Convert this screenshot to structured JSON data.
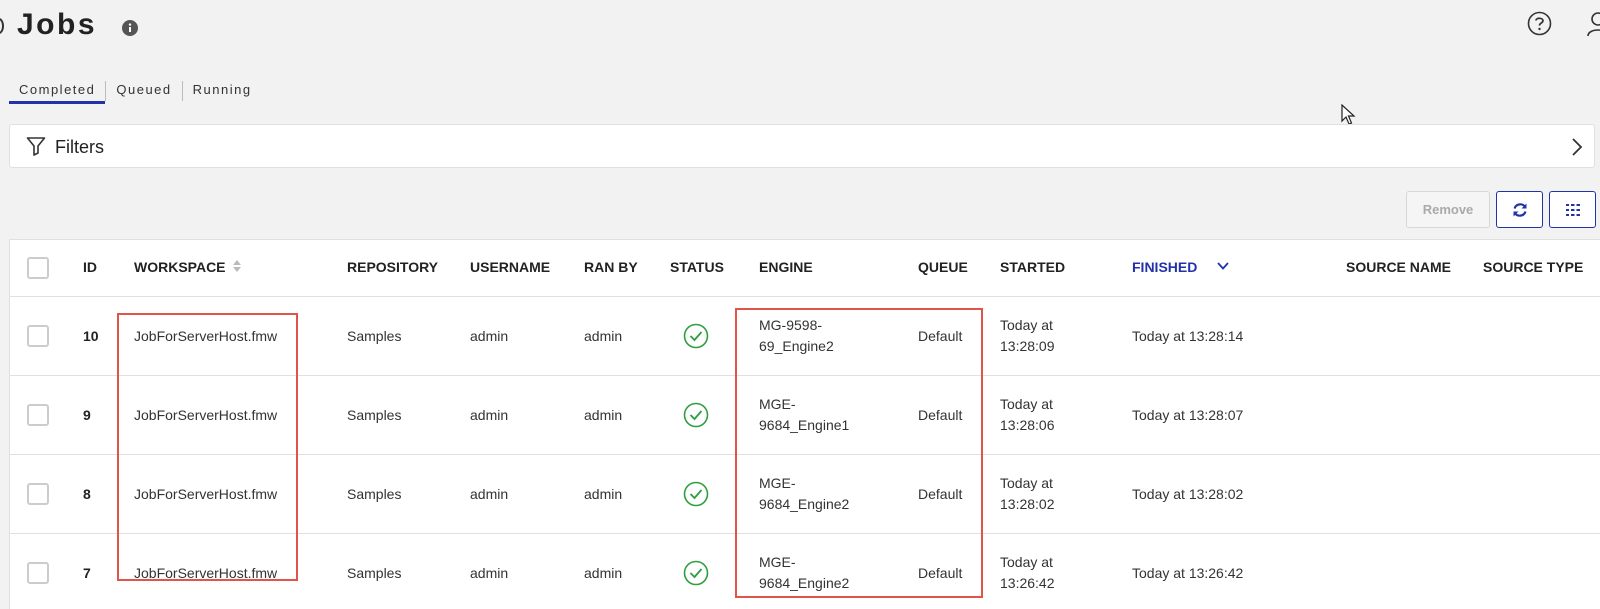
{
  "page": {
    "title": "Jobs"
  },
  "tabs": [
    {
      "label": "Completed"
    },
    {
      "label": "Queued"
    },
    {
      "label": "Running"
    }
  ],
  "filters": {
    "label": "Filters"
  },
  "toolbar": {
    "remove_label": "Remove"
  },
  "table": {
    "columns": {
      "id": "ID",
      "workspace": "WORKSPACE",
      "repository": "REPOSITORY",
      "username": "USERNAME",
      "ran_by": "RAN BY",
      "status": "STATUS",
      "engine": "ENGINE",
      "queue": "QUEUE",
      "started": "STARTED",
      "finished": "FINISHED",
      "source_name": "SOURCE NAME",
      "source_type": "SOURCE TYPE"
    },
    "rows": [
      {
        "id": "10",
        "workspace": "JobForServerHost.fmw",
        "repository": "Samples",
        "username": "admin",
        "ran_by": "admin",
        "status": "success",
        "engine_1": "MG-9598-",
        "engine_2": "69_Engine2",
        "queue": "Default",
        "started_1": "Today at",
        "started_2": "13:28:09",
        "finished": "Today at 13:28:14"
      },
      {
        "id": "9",
        "workspace": "JobForServerHost.fmw",
        "repository": "Samples",
        "username": "admin",
        "ran_by": "admin",
        "status": "success",
        "engine_1": "MGE-",
        "engine_2": "9684_Engine1",
        "queue": "Default",
        "started_1": "Today at",
        "started_2": "13:28:06",
        "finished": "Today at 13:28:07"
      },
      {
        "id": "8",
        "workspace": "JobForServerHost.fmw",
        "repository": "Samples",
        "username": "admin",
        "ran_by": "admin",
        "status": "success",
        "engine_1": "MGE-",
        "engine_2": "9684_Engine2",
        "queue": "Default",
        "started_1": "Today at",
        "started_2": "13:28:02",
        "finished": "Today at 13:28:02"
      },
      {
        "id": "7",
        "workspace": "JobForServerHost.fmw",
        "repository": "Samples",
        "username": "admin",
        "ran_by": "admin",
        "status": "success",
        "engine_1": "MGE-",
        "engine_2": "9684_Engine2",
        "queue": "Default",
        "started_1": "Today at",
        "started_2": "13:26:42",
        "finished": "Today at 13:26:42"
      }
    ]
  },
  "colors": {
    "accent": "#2233aa",
    "success": "#2e9e3e",
    "highlight": "#e05548"
  },
  "icons": [
    "info-icon",
    "help-icon",
    "user-icon",
    "filter-icon",
    "chevron-right-icon",
    "refresh-icon",
    "columns-icon",
    "sort-icon",
    "chevron-down-icon",
    "check-circle-icon"
  ]
}
